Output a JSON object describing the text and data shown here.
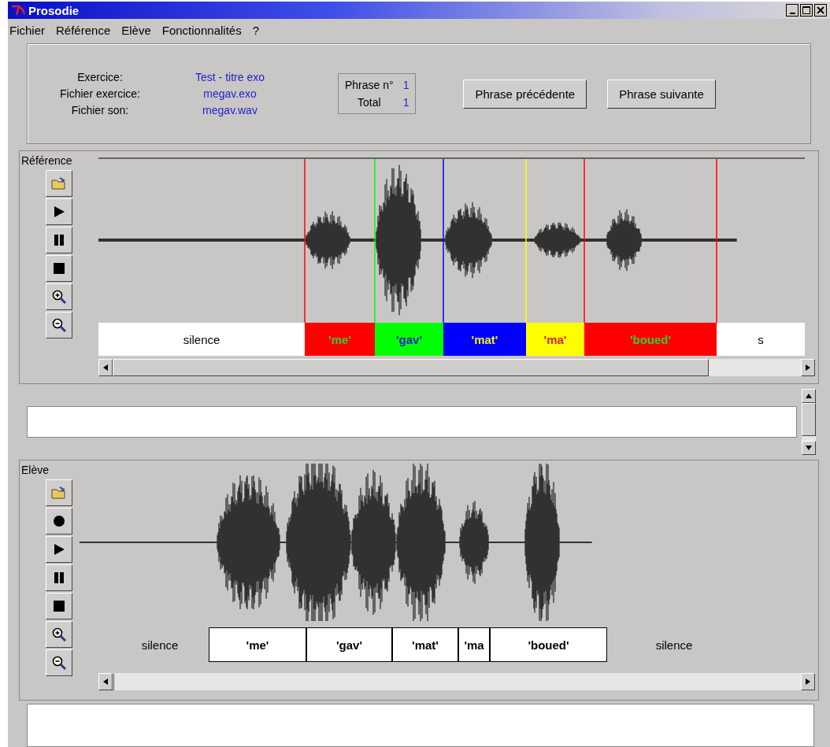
{
  "window": {
    "title": "Prosodie"
  },
  "menu": [
    {
      "label": "Fichier"
    },
    {
      "label": "Référence"
    },
    {
      "label": "Elève"
    },
    {
      "label": "Fonctionnalités"
    },
    {
      "label": "?"
    }
  ],
  "exercise_info": [
    {
      "label": "Exercice:",
      "value": "Test - titre exo"
    },
    {
      "label": "Fichier exercice:",
      "value": "megav.exo"
    },
    {
      "label": "Fichier son:",
      "value": "megav.wav"
    }
  ],
  "phrase_counter": [
    {
      "label": "Phrase n°",
      "value": "1"
    },
    {
      "label": "Total",
      "value": "1"
    }
  ],
  "buttons": [
    "Phrase précédente",
    "Phrase suivante"
  ],
  "reference": {
    "title": "Référence",
    "segments": [
      {
        "kind": "silence",
        "label": "silence",
        "color": "#ffffff"
      },
      {
        "kind": "word",
        "label": "'me'",
        "color": "#ff0000"
      },
      {
        "kind": "word",
        "label": "'gav'",
        "color": "#00ff00"
      },
      {
        "kind": "word",
        "label": "'mat'",
        "color": "#0000ff"
      },
      {
        "kind": "word",
        "label": "'ma'",
        "color": "#ffff00"
      },
      {
        "kind": "word",
        "label": "'boued'",
        "color": "#ff0000"
      },
      {
        "kind": "silence",
        "label": "s",
        "color": "#ffffff"
      }
    ]
  },
  "student": {
    "title": "Elève",
    "segments": [
      {
        "kind": "silence",
        "label": "silence"
      },
      {
        "kind": "word",
        "label": "'me'"
      },
      {
        "kind": "word",
        "label": "'gav'"
      },
      {
        "kind": "word",
        "label": "'mat'"
      },
      {
        "kind": "word",
        "label": "'ma"
      },
      {
        "kind": "word",
        "label": "'boued'"
      },
      {
        "kind": "silence",
        "label": "silence"
      }
    ]
  }
}
